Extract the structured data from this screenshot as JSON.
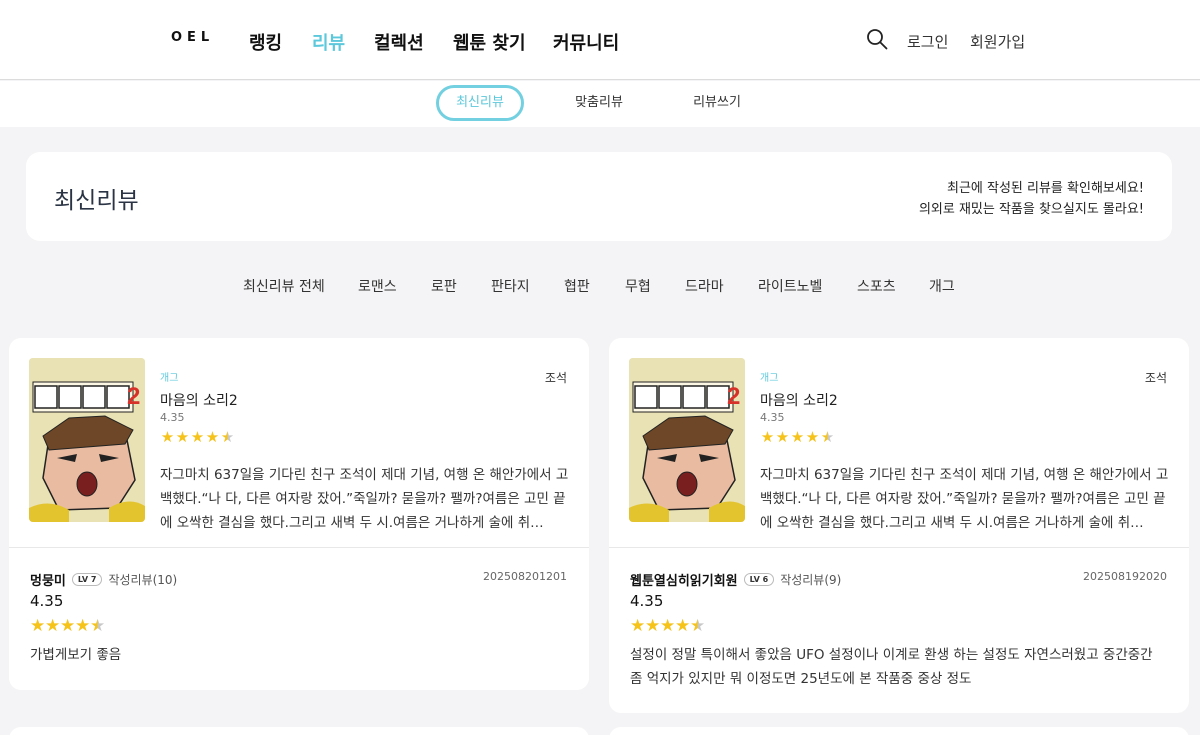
{
  "header": {
    "logo": "OEL",
    "nav": [
      "랭킹",
      "리뷰",
      "컬렉션",
      "웹툰 찾기",
      "커뮤니티"
    ],
    "active_nav": "리뷰",
    "login": "로그인",
    "signup": "회원가입"
  },
  "subnav": {
    "tabs": [
      "최신리뷰",
      "맞춤리뷰",
      "리뷰쓰기"
    ],
    "active": "최신리뷰"
  },
  "banner": {
    "title": "최신리뷰",
    "desc_line1": "최근에 작성된 리뷰를 확인해보세요!",
    "desc_line2": "의외로 재밌는 작품을 찾으실지도 몰라요!"
  },
  "genres": [
    "최신리뷰 전체",
    "로맨스",
    "로판",
    "판타지",
    "협판",
    "무협",
    "드라마",
    "라이트노벨",
    "스포츠",
    "개그"
  ],
  "colors": {
    "accent": "#5cc8db",
    "star": "#f5c31a"
  },
  "cards": [
    {
      "cover_title": "마음의 소리",
      "cover_number": "2",
      "genre": "개그",
      "author": "조석",
      "title": "마음의 소리2",
      "score": "4.35",
      "rating": 4.35,
      "synopsis": "자그마치 637일을 기다린 친구 조석이 제대 기념, 여행 온 해안가에서 고백했다.“나 다, 다른 여자랑 잤어.”죽일까? 묻을까? 팰까?여름은 고민 끝에 오싹한 결심을 했다.그리고 새벽 두 시.여름은 거나하게 술에 취…",
      "reviewer": "멍뭉미",
      "level": "LV 7",
      "review_count": "작성리뷰(10)",
      "date": "202508201201",
      "review_score": "4.35",
      "review_rating": 4.35,
      "review_text": "가볍게보기 좋음"
    },
    {
      "cover_title": "마음의 소리",
      "cover_number": "2",
      "genre": "개그",
      "author": "조석",
      "title": "마음의 소리2",
      "score": "4.35",
      "rating": 4.35,
      "synopsis": "자그마치 637일을 기다린 친구 조석이 제대 기념, 여행 온 해안가에서 고백했다.“나 다, 다른 여자랑 잤어.”죽일까? 묻을까? 팰까?여름은 고민 끝에 오싹한 결심을 했다.그리고 새벽 두 시.여름은 거나하게 술에 취…",
      "reviewer": "웹툰열심히읽기회원",
      "level": "LV 6",
      "review_count": "작성리뷰(9)",
      "date": "202508192020",
      "review_score": "4.35",
      "review_rating": 4.35,
      "review_text": "설정이 정말 특이해서 좋았음 UFO 설정이나 이계로 환생 하는 설정도 자연스러웠고 중간중간 좀 억지가 있지만 뭐 이정도면 25년도에 본 작품중 중상 정도"
    }
  ]
}
